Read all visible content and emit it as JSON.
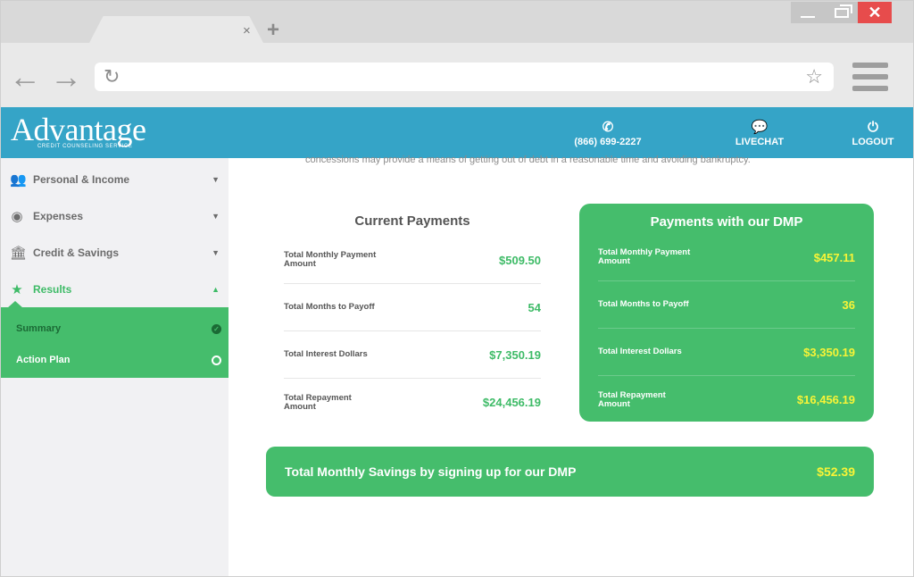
{
  "browser": {
    "close_tab_glyph": "×",
    "new_tab_glyph": "+",
    "close_window_glyph": "✕",
    "back_icon": "arrow-left",
    "forward_icon": "arrow-right",
    "reload_icon": "reload",
    "bookmark_icon": "star",
    "menu_icon": "hamburger"
  },
  "header": {
    "logo_text": "Advantage",
    "logo_subtext": "CREDIT COUNSELING SERVICE",
    "phone": "(866) 699-2227",
    "livechat": "LIVECHAT",
    "logout": "LOGOUT",
    "bg_color": "#35a4c7"
  },
  "sidebar": {
    "items": [
      {
        "label": "Personal & Income",
        "icon": "users-icon"
      },
      {
        "label": "Expenses",
        "icon": "dollar-coin-icon"
      },
      {
        "label": "Credit & Savings",
        "icon": "bank-icon"
      },
      {
        "label": "Results",
        "icon": "star-icon"
      }
    ],
    "subitems": [
      {
        "label": "Summary",
        "status": "complete"
      },
      {
        "label": "Action Plan",
        "status": "incomplete"
      }
    ],
    "accent_color": "#45bd6c"
  },
  "main": {
    "intro_text": "concessions may provide a means of getting out of debt in a reasonable time and avoiding bankruptcy.",
    "current": {
      "title": "Current Payments",
      "rows": [
        {
          "label": "Total Monthly Payment Amount",
          "value": "$509.50"
        },
        {
          "label": "Total Months to Payoff",
          "value": "54"
        },
        {
          "label": "Total Interest Dollars",
          "value": "$7,350.19"
        },
        {
          "label": "Total Repayment Amount",
          "value": "$24,456.19"
        }
      ]
    },
    "dmp": {
      "title": "Payments with our DMP",
      "rows": [
        {
          "label": "Total Monthly Payment Amount",
          "value": "$457.11"
        },
        {
          "label": "Total Months to Payoff",
          "value": "36"
        },
        {
          "label": "Total Interest Dollars",
          "value": "$3,350.19"
        },
        {
          "label": "Total Repayment Amount",
          "value": "$16,456.19"
        }
      ]
    },
    "savings": {
      "label": "Total Monthly Savings by signing up for our DMP",
      "value": "$52.39"
    },
    "value_color": "#3ebb67",
    "highlight_color": "#f8f437"
  }
}
